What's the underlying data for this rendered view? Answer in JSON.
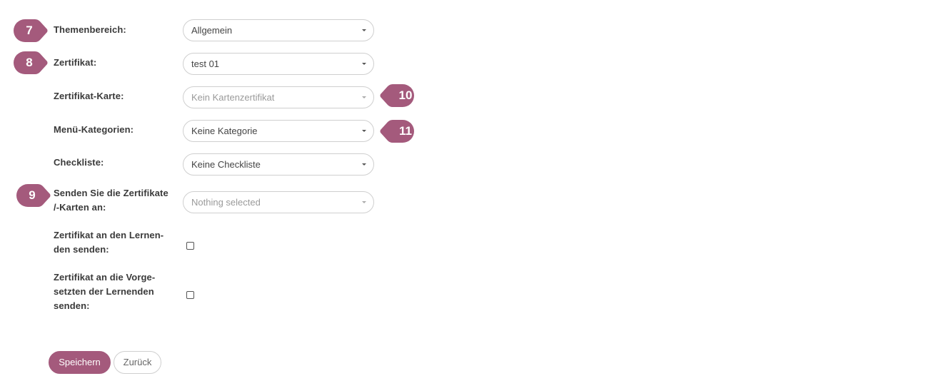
{
  "form": {
    "themenbereich": {
      "label": "Themenbereich:",
      "value": "Allgemein"
    },
    "zertifikat": {
      "label": "Zertifikat:",
      "value": "test 01"
    },
    "zertifikat_karte": {
      "label": "Zertifikat-Karte:",
      "value": "Kein Kartenzertifikat"
    },
    "menu_kategorien": {
      "label": "Menü-Kategorien:",
      "value": "Keine Kategorie"
    },
    "checkliste": {
      "label": "Checkliste:",
      "value": "Keine Checkliste"
    },
    "senden_an": {
      "label_line1": "Senden Sie die Zertifikate",
      "label_line2": "/-Karten an:",
      "value": "Nothing selected"
    },
    "an_lernende": {
      "label_line1": "Zertifikat an den Lernen-",
      "label_line2": "den senden:",
      "checked": false
    },
    "an_vorgesetzte": {
      "label_line1": "Zertifikat an die Vorge-",
      "label_line2": "setzten der Lernenden",
      "label_line3": "senden:",
      "checked": false
    }
  },
  "markers": {
    "m7": "7",
    "m8": "8",
    "m9": "9",
    "m10": "10",
    "m11": "11"
  },
  "buttons": {
    "save": "Speichern",
    "back": "Zurück"
  },
  "colors": {
    "accent": "#a45a7c",
    "border": "#cfcfcf"
  }
}
